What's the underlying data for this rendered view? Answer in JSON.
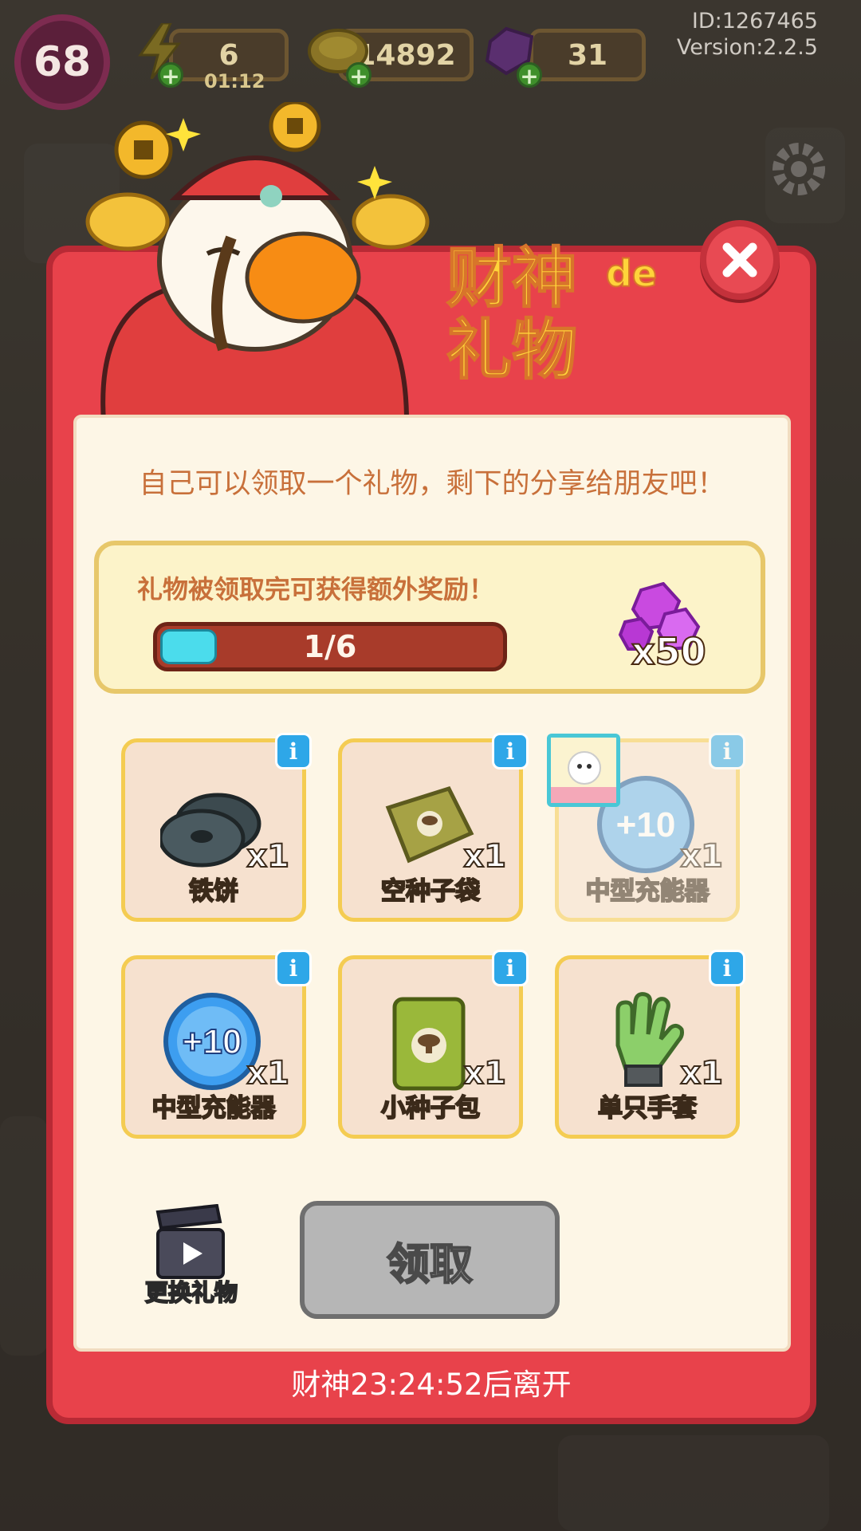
{
  "hud": {
    "level": "68",
    "energy": "6",
    "energy_timer": "01:12",
    "coins": "14892",
    "gems": "31",
    "id_text": "ID:1267465",
    "version_text": "Version:2.2.5"
  },
  "dialog": {
    "title_line1": "财神",
    "title_de": "de",
    "title_line2": "礼物",
    "subtitle": "自己可以领取一个礼物，剩下的分享给朋友吧！",
    "progress": {
      "caption": "礼物被领取完可获得额外奖励！",
      "label": "1/6",
      "current": 1,
      "total": 6,
      "reward_qty": "x50"
    },
    "gifts": [
      {
        "name": "铁饼",
        "qty": "x1",
        "icon": "discus-icon",
        "available": true
      },
      {
        "name": "空种子袋",
        "qty": "x1",
        "icon": "empty-seed-bag-icon",
        "available": true
      },
      {
        "name": "中型充能器",
        "qty": "x1",
        "icon": "charger-icon",
        "available": false
      },
      {
        "name": "中型充能器",
        "qty": "x1",
        "icon": "charger-icon",
        "available": true
      },
      {
        "name": "小种子包",
        "qty": "x1",
        "icon": "seed-pack-icon",
        "available": true
      },
      {
        "name": "单只手套",
        "qty": "x1",
        "icon": "glove-icon",
        "available": true
      }
    ],
    "change_gift_label": "更换礼物",
    "claim_label": "领取",
    "footer": "财神23:24:52后离开"
  },
  "colors": {
    "dialog_red": "#e8424b",
    "panel_cream": "#fdf6e6",
    "progress_fill": "#4bdcec",
    "info_blue": "#2ea7e8",
    "claim_disabled": "#b6b6b6"
  }
}
